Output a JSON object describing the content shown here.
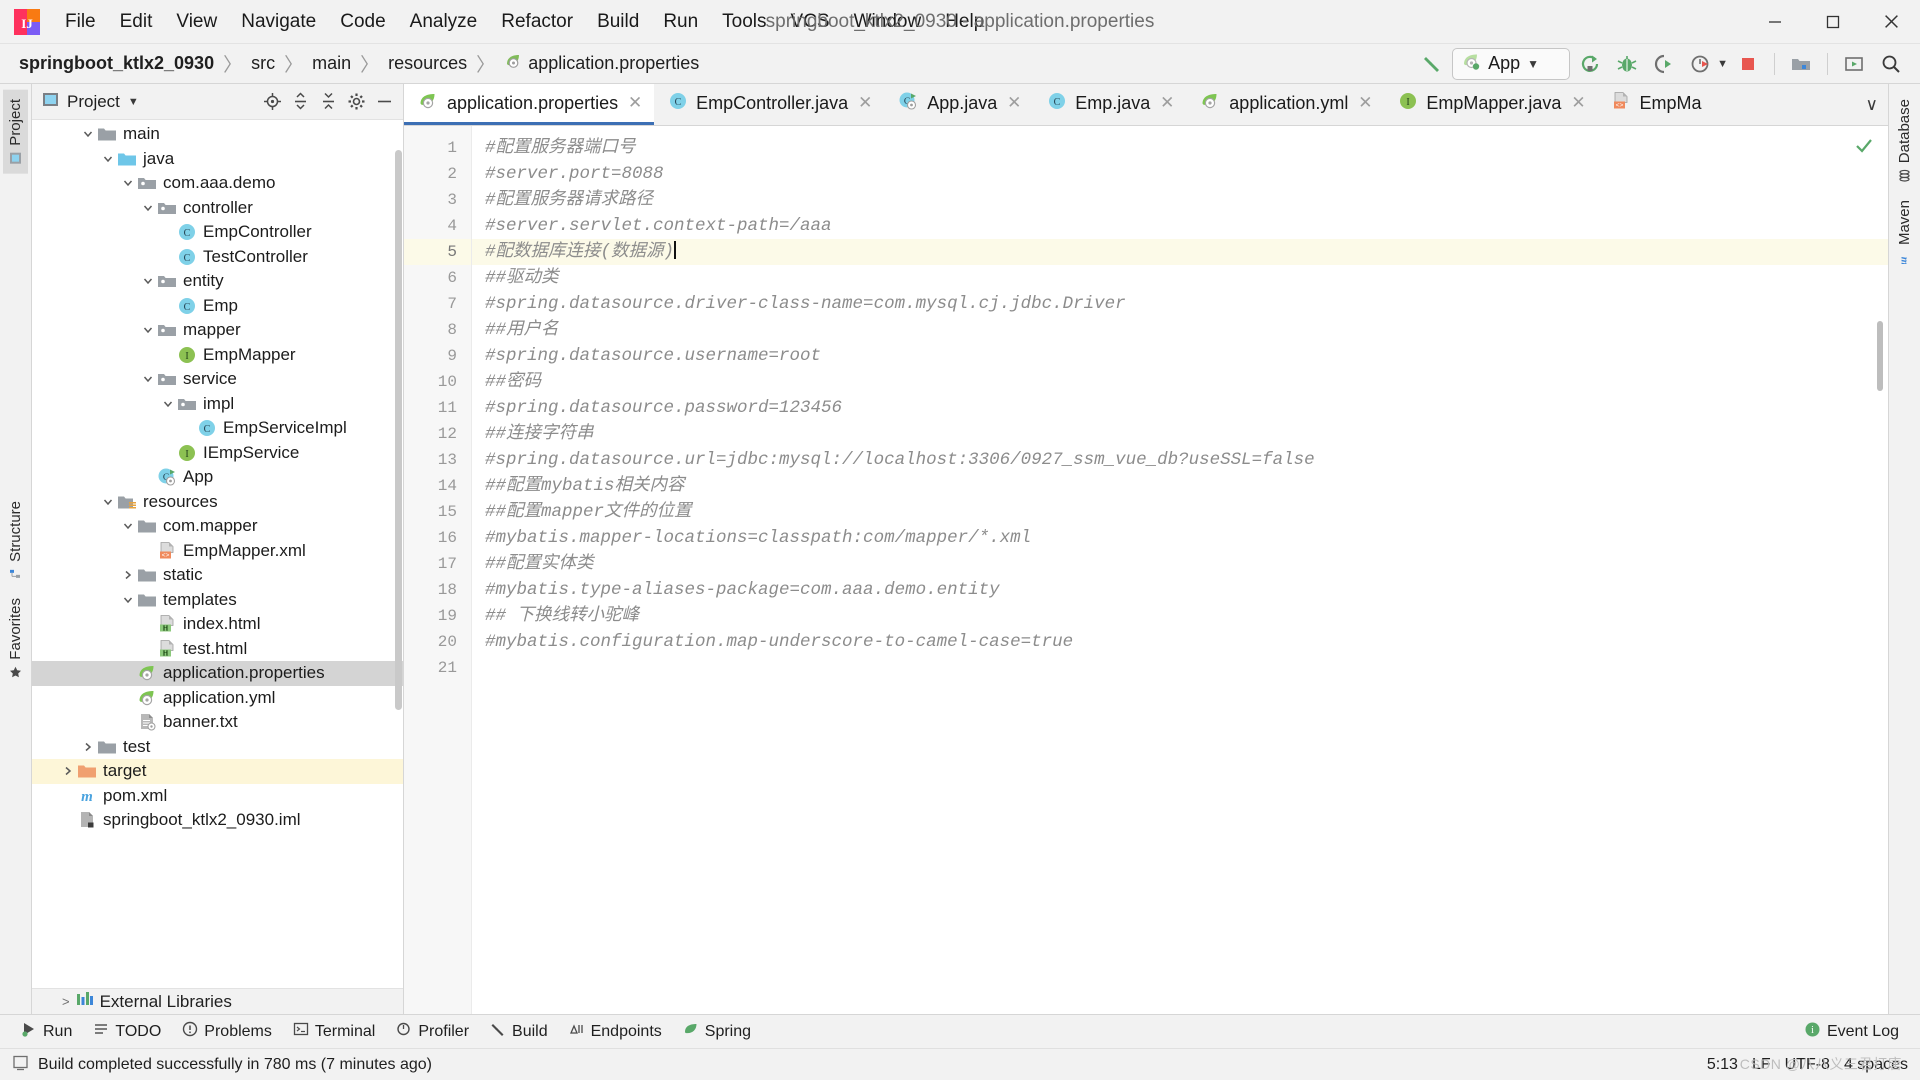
{
  "window": {
    "title": "springboot_ktlx2_0930 - application.properties",
    "minimize_label": "–",
    "maximize_label": "□",
    "close_label": "✕"
  },
  "menubar": {
    "items": [
      "File",
      "Edit",
      "View",
      "Navigate",
      "Code",
      "Analyze",
      "Refactor",
      "Build",
      "Run",
      "Tools",
      "VCS",
      "Window",
      "Help"
    ]
  },
  "navbar": {
    "breadcrumbs": [
      {
        "label": "springboot_ktlx2_0930",
        "bold": true,
        "icon": ""
      },
      {
        "label": "src",
        "bold": false,
        "icon": ""
      },
      {
        "label": "main",
        "bold": false,
        "icon": ""
      },
      {
        "label": "resources",
        "bold": false,
        "icon": ""
      },
      {
        "label": "application.properties",
        "bold": false,
        "icon": "spring-leaf-icon"
      }
    ],
    "separator": "〉",
    "run_config": {
      "label": "App",
      "icon": "spring-boot-run-icon",
      "chevron": "▼"
    },
    "buttons": [
      {
        "name": "build-hammer-icon",
        "title": "Build"
      },
      {
        "name": "run-icon",
        "title": "Run"
      },
      {
        "name": "debug-icon",
        "title": "Debug"
      },
      {
        "name": "run-with-coverage-icon",
        "title": "Run with Coverage"
      },
      {
        "name": "profiler-icon",
        "title": "Profiler"
      },
      {
        "name": "stop-icon",
        "title": "Stop"
      },
      {
        "name": "project-structure-icon",
        "title": "Project Structure"
      },
      {
        "name": "updates-icon",
        "title": "Updates"
      },
      {
        "name": "search-everywhere-icon",
        "title": "Search Everywhere"
      }
    ]
  },
  "left_strip": {
    "tabs": [
      {
        "label": "Project",
        "icon": "project-icon",
        "selected": true
      },
      {
        "label": "Structure",
        "icon": "structure-icon",
        "selected": false
      },
      {
        "label": "Favorites",
        "icon": "favorites-icon",
        "selected": false
      }
    ]
  },
  "right_strip": {
    "tabs": [
      {
        "label": "Database",
        "icon": "database-icon"
      },
      {
        "label": "Maven",
        "icon": "maven-icon"
      }
    ]
  },
  "project_panel": {
    "title": "Project",
    "chevron": "▼",
    "header_buttons": [
      {
        "name": "locate-file-icon",
        "title": "Select Opened File"
      },
      {
        "name": "expand-all-icon",
        "title": "Expand All"
      },
      {
        "name": "collapse-all-icon",
        "title": "Collapse All"
      },
      {
        "name": "settings-gear-icon",
        "title": "Settings"
      },
      {
        "name": "hide-panel-icon",
        "title": "Hide"
      }
    ],
    "tree": [
      {
        "label": "main",
        "depth": 2,
        "twisty": "v",
        "icon": "folder-gray",
        "state": "none"
      },
      {
        "label": "java",
        "depth": 3,
        "twisty": "v",
        "icon": "folder-blue",
        "state": "none"
      },
      {
        "label": "com.aaa.demo",
        "depth": 4,
        "twisty": "v",
        "icon": "folder-package",
        "state": "none"
      },
      {
        "label": "controller",
        "depth": 5,
        "twisty": "v",
        "icon": "folder-package",
        "state": "none"
      },
      {
        "label": "EmpController",
        "depth": 6,
        "twisty": "",
        "icon": "class-icon",
        "state": "none"
      },
      {
        "label": "TestController",
        "depth": 6,
        "twisty": "",
        "icon": "class-icon",
        "state": "none"
      },
      {
        "label": "entity",
        "depth": 5,
        "twisty": "v",
        "icon": "folder-package",
        "state": "none"
      },
      {
        "label": "Emp",
        "depth": 6,
        "twisty": "",
        "icon": "class-icon",
        "state": "none"
      },
      {
        "label": "mapper",
        "depth": 5,
        "twisty": "v",
        "icon": "folder-package",
        "state": "none"
      },
      {
        "label": "EmpMapper",
        "depth": 6,
        "twisty": "",
        "icon": "interface-icon",
        "state": "none"
      },
      {
        "label": "service",
        "depth": 5,
        "twisty": "v",
        "icon": "folder-package",
        "state": "none"
      },
      {
        "label": "impl",
        "depth": 6,
        "twisty": "v",
        "icon": "folder-package",
        "state": "none"
      },
      {
        "label": "EmpServiceImpl",
        "depth": 7,
        "twisty": "",
        "icon": "class-icon",
        "state": "none"
      },
      {
        "label": "IEmpService",
        "depth": 6,
        "twisty": "",
        "icon": "interface-icon",
        "state": "none"
      },
      {
        "label": "App",
        "depth": 5,
        "twisty": "",
        "icon": "spring-class-icon",
        "state": "none"
      },
      {
        "label": "resources",
        "depth": 3,
        "twisty": "v",
        "icon": "folder-resources",
        "state": "none"
      },
      {
        "label": "com.mapper",
        "depth": 4,
        "twisty": "v",
        "icon": "folder-gray",
        "state": "none"
      },
      {
        "label": "EmpMapper.xml",
        "depth": 5,
        "twisty": "",
        "icon": "xml-icon",
        "state": "none"
      },
      {
        "label": "static",
        "depth": 4,
        "twisty": ">",
        "icon": "folder-gray",
        "state": "none"
      },
      {
        "label": "templates",
        "depth": 4,
        "twisty": "v",
        "icon": "folder-gray",
        "state": "none"
      },
      {
        "label": "index.html",
        "depth": 5,
        "twisty": "",
        "icon": "html-icon",
        "state": "none"
      },
      {
        "label": "test.html",
        "depth": 5,
        "twisty": "",
        "icon": "html-icon",
        "state": "none"
      },
      {
        "label": "application.properties",
        "depth": 4,
        "twisty": "",
        "icon": "spring-leaf-icon",
        "state": "selected"
      },
      {
        "label": "application.yml",
        "depth": 4,
        "twisty": "",
        "icon": "spring-leaf-icon",
        "state": "none"
      },
      {
        "label": "banner.txt",
        "depth": 4,
        "twisty": "",
        "icon": "text-file-icon",
        "state": "none"
      },
      {
        "label": "test",
        "depth": 2,
        "twisty": ">",
        "icon": "folder-gray",
        "state": "none"
      },
      {
        "label": "target",
        "depth": 1,
        "twisty": ">",
        "icon": "folder-orange",
        "state": "highlight"
      },
      {
        "label": "pom.xml",
        "depth": 1,
        "twisty": "",
        "icon": "maven-pom-icon",
        "state": "none"
      },
      {
        "label": "springboot_ktlx2_0930.iml",
        "depth": 1,
        "twisty": "",
        "icon": "iml-icon",
        "state": "none"
      }
    ],
    "footer": {
      "label": "External Libraries",
      "twisty": ">",
      "icon": "libraries-icon"
    }
  },
  "editor": {
    "tabs": [
      {
        "label": "application.properties",
        "icon": "spring-leaf-icon",
        "active": true,
        "close": "✕"
      },
      {
        "label": "EmpController.java",
        "icon": "class-icon",
        "active": false,
        "close": "✕"
      },
      {
        "label": "App.java",
        "icon": "spring-class-icon",
        "active": false,
        "close": "✕"
      },
      {
        "label": "Emp.java",
        "icon": "class-icon",
        "active": false,
        "close": "✕"
      },
      {
        "label": "application.yml",
        "icon": "spring-leaf-icon",
        "active": false,
        "close": "✕"
      },
      {
        "label": "EmpMapper.java",
        "icon": "interface-icon",
        "active": false,
        "close": "✕"
      },
      {
        "label": "EmpMa",
        "icon": "xml-icon",
        "active": false,
        "close": ""
      }
    ],
    "tabs_more_chevron": "∨",
    "inspection_status": "ok",
    "lines": [
      {
        "n": "1",
        "text": "#配置服务器端口号"
      },
      {
        "n": "2",
        "text": "#server.port=8088"
      },
      {
        "n": "3",
        "text": "#配置服务器请求路径"
      },
      {
        "n": "4",
        "text": "#server.servlet.context-path=/aaa"
      },
      {
        "n": "5",
        "text": "#配数据库连接(数据源)",
        "caret": true,
        "current": true
      },
      {
        "n": "6",
        "text": "##驱动类"
      },
      {
        "n": "7",
        "text": "#spring.datasource.driver-class-name=com.mysql.cj.jdbc.Driver"
      },
      {
        "n": "8",
        "text": "##用户名"
      },
      {
        "n": "9",
        "text": "#spring.datasource.username=root"
      },
      {
        "n": "10",
        "text": "##密码"
      },
      {
        "n": "11",
        "text": "#spring.datasource.password=123456"
      },
      {
        "n": "12",
        "text": "##连接字符串"
      },
      {
        "n": "13",
        "text": "#spring.datasource.url=jdbc:mysql://localhost:3306/0927_ssm_vue_db?useSSL=false"
      },
      {
        "n": "14",
        "text": "##配置mybatis相关内容"
      },
      {
        "n": "15",
        "text": "##配置mapper文件的位置"
      },
      {
        "n": "16",
        "text": "#mybatis.mapper-locations=classpath:com/mapper/*.xml"
      },
      {
        "n": "17",
        "text": "##配置实体类"
      },
      {
        "n": "18",
        "text": "#mybatis.type-aliases-package=com.aaa.demo.entity"
      },
      {
        "n": "19",
        "text": "## 下换线转小驼峰"
      },
      {
        "n": "20",
        "text": "#mybatis.configuration.map-underscore-to-camel-case=true"
      },
      {
        "n": "21",
        "text": ""
      }
    ]
  },
  "bottom_bar": {
    "items": [
      {
        "label": "Run",
        "icon": "run-icon"
      },
      {
        "label": "TODO",
        "icon": "todo-icon"
      },
      {
        "label": "Problems",
        "icon": "problems-icon"
      },
      {
        "label": "Terminal",
        "icon": "terminal-icon"
      },
      {
        "label": "Profiler",
        "icon": "profiler-icon"
      },
      {
        "label": "Build",
        "icon": "build-hammer-icon"
      },
      {
        "label": "Endpoints",
        "icon": "endpoints-icon"
      },
      {
        "label": "Spring",
        "icon": "spring-leaf-icon"
      }
    ],
    "event_log": {
      "label": "Event Log",
      "icon": "event-log-icon"
    }
  },
  "status_bar": {
    "message": "Build completed successfully in 780 ms (7 minutes ago)",
    "icon": "status-message-icon",
    "caret_position": "5:13",
    "line_separator": "LF",
    "encoding": "UTF-8",
    "indent": "4 spaces",
    "watermark": "CSDN @八八义三君打唐"
  },
  "colors": {
    "accent_blue": "#3c6fb4",
    "spring_green": "#6db33f",
    "class_blue": "#7fd1e8",
    "interface_green": "#8cc152",
    "folder_gray": "#9aa0a6",
    "folder_blue": "#6ec6e8",
    "folder_orange": "#f0a070",
    "selection_gray": "#d4d4d4",
    "highlight_yellow": "#fdf6d8",
    "stop_red": "#e8564f"
  }
}
